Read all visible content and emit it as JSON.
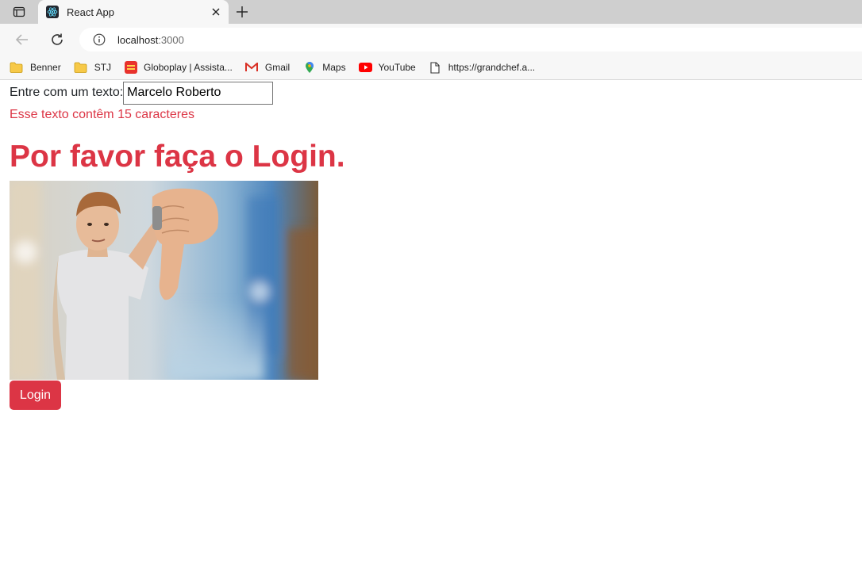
{
  "browser": {
    "tab_title": "React App",
    "new_tab_label": "+",
    "address_host": "localhost",
    "address_port": ":3000",
    "bookmarks": [
      {
        "label": "Benner",
        "icon": "folder-icon"
      },
      {
        "label": "STJ",
        "icon": "folder-icon"
      },
      {
        "label": "Globoplay | Assista...",
        "icon": "globoplay-icon"
      },
      {
        "label": "Gmail",
        "icon": "gmail-icon"
      },
      {
        "label": "Maps",
        "icon": "maps-icon"
      },
      {
        "label": "YouTube",
        "icon": "youtube-icon"
      },
      {
        "label": "https://grandchef.a...",
        "icon": "page-icon"
      }
    ]
  },
  "app": {
    "input_label": "Entre com um texto:",
    "input_value": "Marcelo Roberto",
    "char_count_text": "Esse texto contêm 15 caracteres",
    "heading": "Por favor faça o Login.",
    "login_button": "Login",
    "accent_color": "#dc3545"
  }
}
